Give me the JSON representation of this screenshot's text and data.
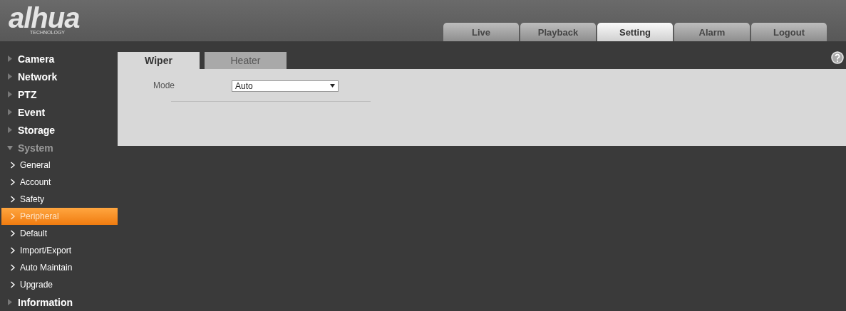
{
  "logo": {
    "wordmark": "alhua",
    "tagline": "TECHNOLOGY"
  },
  "nav_tabs": [
    {
      "label": "Live",
      "selected": false
    },
    {
      "label": "Playback",
      "selected": false
    },
    {
      "label": "Setting",
      "selected": true
    },
    {
      "label": "Alarm",
      "selected": false
    },
    {
      "label": "Logout",
      "selected": false
    }
  ],
  "sidebar": {
    "items": [
      {
        "label": "Camera",
        "expanded": false
      },
      {
        "label": "Network",
        "expanded": false
      },
      {
        "label": "PTZ",
        "expanded": false
      },
      {
        "label": "Event",
        "expanded": false
      },
      {
        "label": "Storage",
        "expanded": false
      },
      {
        "label": "System",
        "expanded": true,
        "children": [
          {
            "label": "General",
            "selected": false
          },
          {
            "label": "Account",
            "selected": false
          },
          {
            "label": "Safety",
            "selected": false
          },
          {
            "label": "Peripheral",
            "selected": true
          },
          {
            "label": "Default",
            "selected": false
          },
          {
            "label": "Import/Export",
            "selected": false
          },
          {
            "label": "Auto Maintain",
            "selected": false
          },
          {
            "label": "Upgrade",
            "selected": false
          }
        ]
      },
      {
        "label": "Information",
        "expanded": false
      }
    ]
  },
  "panel": {
    "tabs": [
      {
        "label": "Wiper",
        "selected": true
      },
      {
        "label": "Heater",
        "selected": false
      }
    ],
    "form": [
      {
        "label": "Mode",
        "value": "Auto"
      }
    ]
  }
}
